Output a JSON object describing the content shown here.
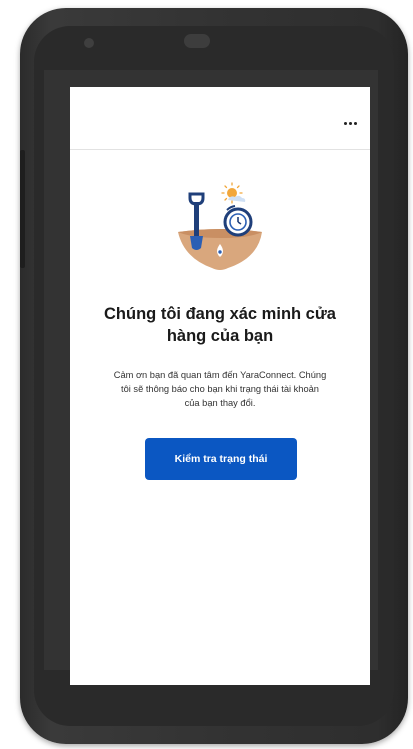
{
  "appbar": {
    "menu_icon": "more-horizontal-icon"
  },
  "illustration": {
    "icon": "shovel-clock-sun-illustration"
  },
  "main": {
    "title_line1": "Chúng tôi đang xác minh cửa",
    "title_line2": "hàng của bạn",
    "description_line1": "Cảm ơn bạn đã quan tâm đến YaraConnect. Chúng",
    "description_line2": "tôi sẽ thông báo cho bạn khi trạng thái tài khoản",
    "description_line3": "của bạn thay đổi.",
    "button_label": "Kiểm tra trạng thái"
  },
  "colors": {
    "primary": "#0b57c2",
    "accent_sun": "#f2a73b",
    "earth": "#d9a77d"
  }
}
